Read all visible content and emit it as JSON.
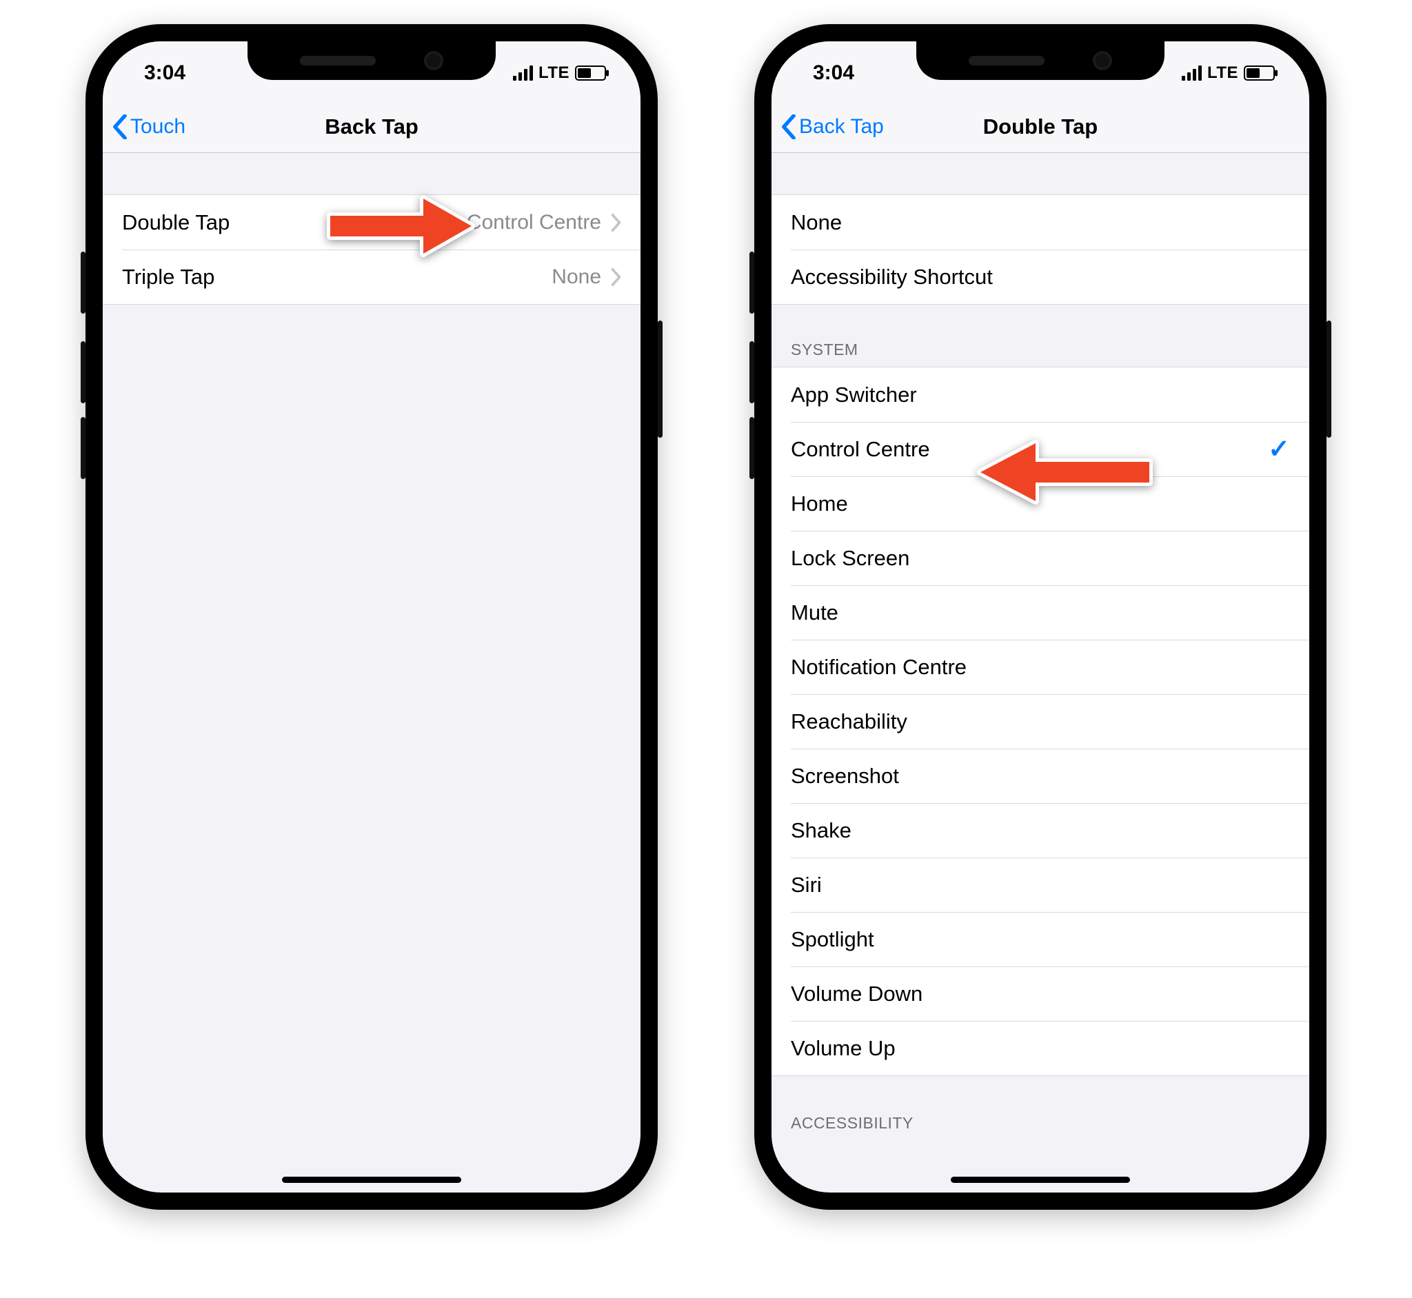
{
  "status": {
    "time": "3:04",
    "network": "LTE"
  },
  "phone1": {
    "back_label": "Touch",
    "title": "Back Tap",
    "rows": [
      {
        "label": "Double Tap",
        "value": "Control Centre"
      },
      {
        "label": "Triple Tap",
        "value": "None"
      }
    ]
  },
  "phone2": {
    "back_label": "Back Tap",
    "title": "Double Tap",
    "top_rows": [
      "None",
      "Accessibility Shortcut"
    ],
    "section_system_header": "SYSTEM",
    "system_rows": [
      {
        "label": "App Switcher",
        "checked": false
      },
      {
        "label": "Control Centre",
        "checked": true
      },
      {
        "label": "Home",
        "checked": false
      },
      {
        "label": "Lock Screen",
        "checked": false
      },
      {
        "label": "Mute",
        "checked": false
      },
      {
        "label": "Notification Centre",
        "checked": false
      },
      {
        "label": "Reachability",
        "checked": false
      },
      {
        "label": "Screenshot",
        "checked": false
      },
      {
        "label": "Shake",
        "checked": false
      },
      {
        "label": "Siri",
        "checked": false
      },
      {
        "label": "Spotlight",
        "checked": false
      },
      {
        "label": "Volume Down",
        "checked": false
      },
      {
        "label": "Volume Up",
        "checked": false
      }
    ],
    "section_accessibility_header": "ACCESSIBILITY"
  }
}
